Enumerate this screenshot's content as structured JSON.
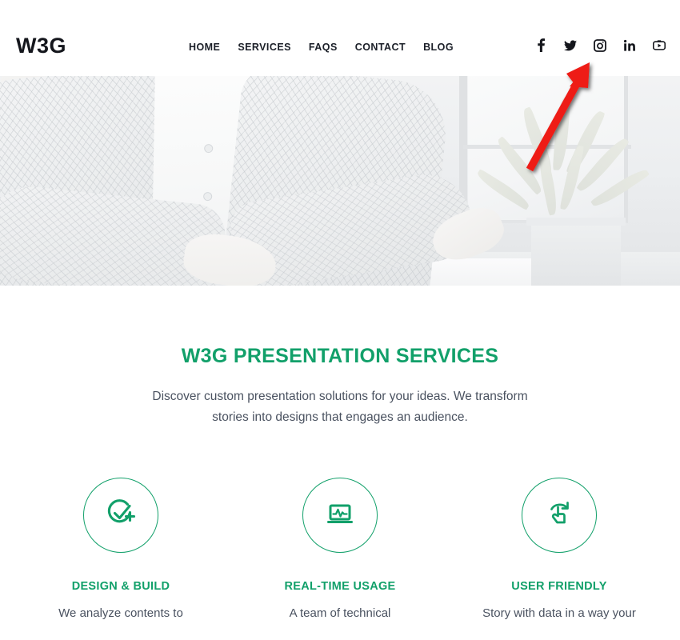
{
  "header": {
    "logo": "W3G",
    "nav": [
      {
        "label": "HOME"
      },
      {
        "label": "SERVICES"
      },
      {
        "label": "FAQS"
      },
      {
        "label": "CONTACT"
      },
      {
        "label": "BLOG"
      }
    ],
    "social": [
      {
        "name": "facebook-icon",
        "label": "Facebook"
      },
      {
        "name": "twitter-icon",
        "label": "Twitter"
      },
      {
        "name": "instagram-icon",
        "label": "Instagram"
      },
      {
        "name": "linkedin-icon",
        "label": "LinkedIn"
      },
      {
        "name": "youtube-icon",
        "label": "YouTube"
      }
    ]
  },
  "hero": {
    "alt": "Person in light plaid blazer working at a desk beside a potted plant, faded background image"
  },
  "annotation": {
    "type": "arrow",
    "color": "#ee1c18",
    "points_to": "instagram-icon"
  },
  "services": {
    "title": "W3G PRESENTATION SERVICES",
    "subtitle": "Discover custom presentation solutions for your ideas. We transform stories into designs that engages an audience.",
    "features": [
      {
        "icon": "check-plus-icon",
        "title": "DESIGN & BUILD",
        "description": "We analyze contents to"
      },
      {
        "icon": "laptop-chart-icon",
        "title": "REAL-TIME USAGE",
        "description": "A team of technical"
      },
      {
        "icon": "tap-gesture-icon",
        "title": "USER FRIENDLY",
        "description": "Story with data in a way your"
      }
    ]
  },
  "colors": {
    "brand_green": "#12a06a",
    "text_dark": "#14161c",
    "text_body": "#4a5260",
    "annotation_red": "#ee1c18"
  }
}
